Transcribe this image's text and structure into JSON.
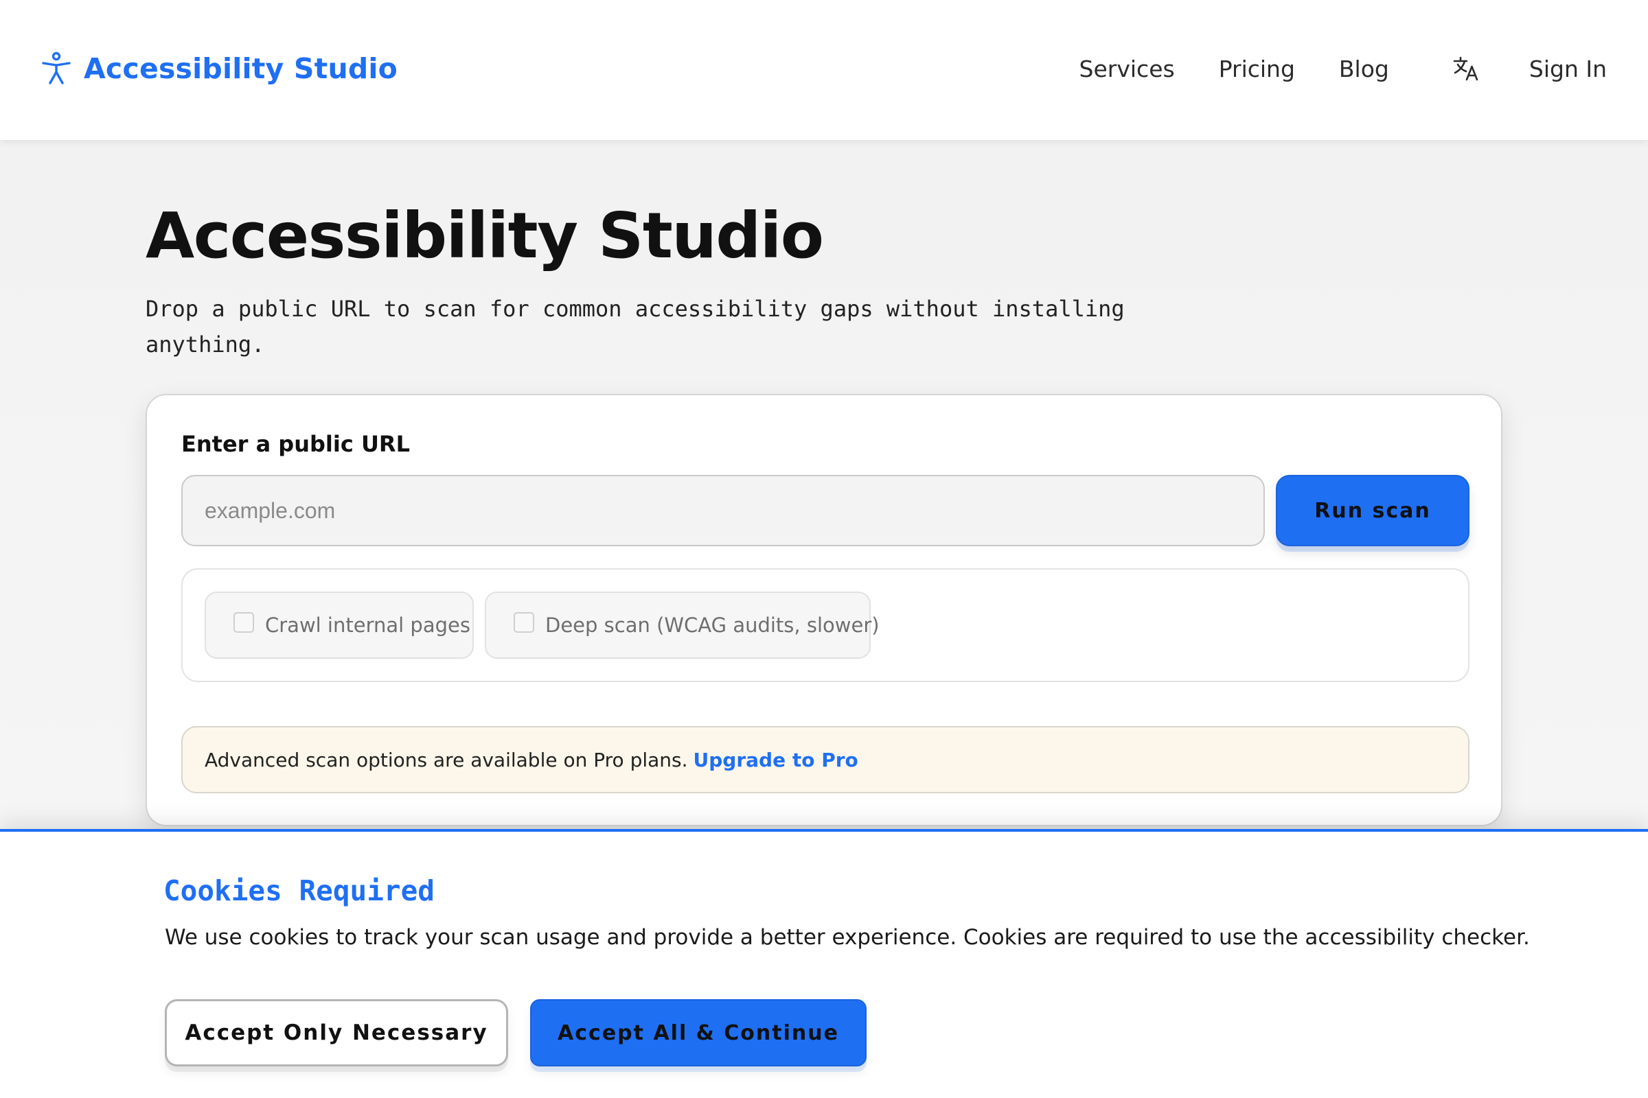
{
  "colors": {
    "accent": "#1f6ff3",
    "notice_background": "#fcf7ea",
    "page_background": "#f3f3f3"
  },
  "header": {
    "brand": {
      "name": "Accessibility Studio",
      "icon": "accessibility-person-icon"
    },
    "nav": [
      {
        "label": "Services"
      },
      {
        "label": "Pricing"
      },
      {
        "label": "Blog"
      }
    ],
    "language_icon": "translate-icon",
    "sign_in": "Sign In"
  },
  "hero": {
    "title": "Accessibility Studio",
    "subtitle": "Drop a public URL to scan for common accessibility gaps without installing anything."
  },
  "scan_form": {
    "label": "Enter a public URL",
    "input_value": "",
    "input_placeholder": "example.com",
    "submit_label": "Run scan",
    "options": [
      {
        "label": "Crawl internal pages",
        "checked": false
      },
      {
        "label": "Deep scan (WCAG audits, slower)",
        "checked": false
      }
    ],
    "notice_text": "Advanced scan options are available on Pro plans.",
    "notice_link": "Upgrade to Pro"
  },
  "cookie_banner": {
    "title": "Cookies Required",
    "message": "We use cookies to track your scan usage and provide a better experience. Cookies are required to use the accessibility checker.",
    "secondary_button": "Accept Only Necessary",
    "primary_button": "Accept All & Continue"
  }
}
